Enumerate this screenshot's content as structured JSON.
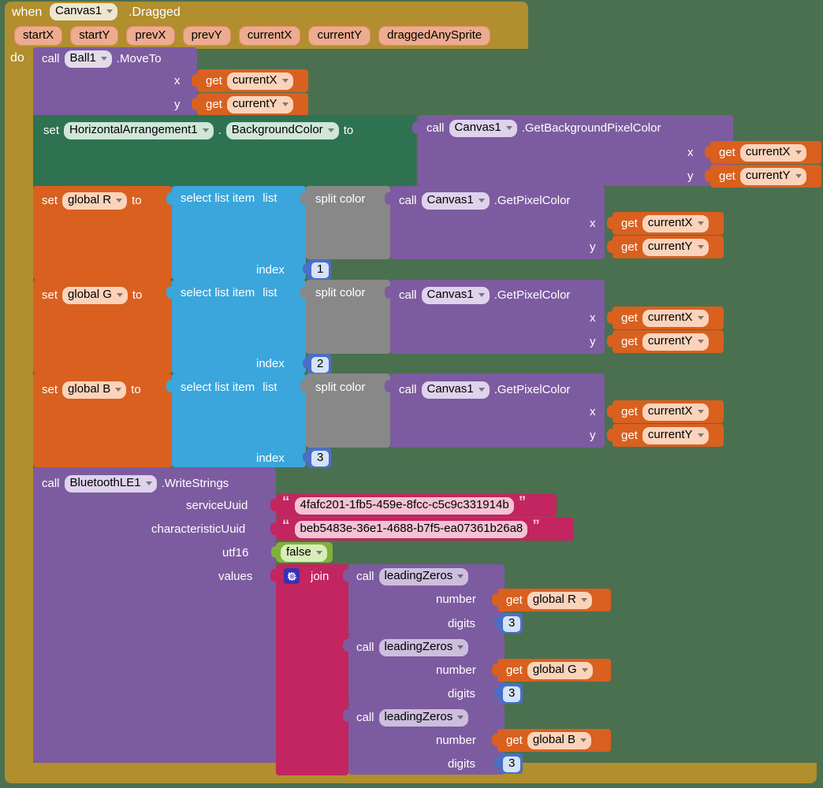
{
  "canvas": {
    "background_color": "#4a7050"
  },
  "event": {
    "when_label": "when",
    "component": "Canvas1",
    "event_name": ".Dragged",
    "params": [
      "startX",
      "startY",
      "prevX",
      "prevY",
      "currentX",
      "currentY",
      "draggedAnySprite"
    ],
    "do_label": "do",
    "color": "#b18e2e"
  },
  "moveto": {
    "call_label": "call",
    "component": "Ball1",
    "method": ".MoveTo",
    "args": [
      {
        "name": "x",
        "get_label": "get",
        "value": "currentX"
      },
      {
        "name": "y",
        "get_label": "get",
        "value": "currentY"
      }
    ],
    "color": "#7d5ba0"
  },
  "set_bgcolor": {
    "set_label": "set",
    "component": "HorizontalArrangement1",
    "dot": ".",
    "property": "BackgroundColor",
    "to_label": "to",
    "color": "#2e7252",
    "value": {
      "call_label": "call",
      "component": "Canvas1",
      "method": ".GetBackgroundPixelColor",
      "args": [
        {
          "name": "x",
          "get_label": "get",
          "value": "currentX"
        },
        {
          "name": "y",
          "get_label": "get",
          "value": "currentY"
        }
      ]
    }
  },
  "rgb_setters": [
    {
      "set_label": "set",
      "variable": "global R",
      "to_label": "to",
      "select_label": "select list item",
      "list_label": "list",
      "split_label": "split color",
      "index_label": "index",
      "index_value": "1",
      "call_label": "call",
      "component": "Canvas1",
      "method": ".GetPixelColor",
      "args": [
        {
          "name": "x",
          "get_label": "get",
          "value": "currentX"
        },
        {
          "name": "y",
          "get_label": "get",
          "value": "currentY"
        }
      ]
    },
    {
      "set_label": "set",
      "variable": "global G",
      "to_label": "to",
      "select_label": "select list item",
      "list_label": "list",
      "split_label": "split color",
      "index_label": "index",
      "index_value": "2",
      "call_label": "call",
      "component": "Canvas1",
      "method": ".GetPixelColor",
      "args": [
        {
          "name": "x",
          "get_label": "get",
          "value": "currentX"
        },
        {
          "name": "y",
          "get_label": "get",
          "value": "currentY"
        }
      ]
    },
    {
      "set_label": "set",
      "variable": "global B",
      "to_label": "to",
      "select_label": "select list item",
      "list_label": "list",
      "split_label": "split color",
      "index_label": "index",
      "index_value": "3",
      "call_label": "call",
      "component": "Canvas1",
      "method": ".GetPixelColor",
      "args": [
        {
          "name": "x",
          "get_label": "get",
          "value": "currentX"
        },
        {
          "name": "y",
          "get_label": "get",
          "value": "currentY"
        }
      ]
    }
  ],
  "write_strings": {
    "call_label": "call",
    "component": "BluetoothLE1",
    "method": ".WriteStrings",
    "color": "#7d5ba0",
    "params": {
      "service_uuid_label": "serviceUuid",
      "service_uuid_value": "4fafc201-1fb5-459e-8fcc-c5c9c331914b",
      "characteristic_uuid_label": "characteristicUuid",
      "characteristic_uuid_value": "beb5483e-36e1-4688-b7f5-ea07361b26a8",
      "utf16_label": "utf16",
      "utf16_value": "false",
      "values_label": "values"
    },
    "join": {
      "label": "join",
      "mutator_icon": "gear-icon",
      "color": "#c2255f",
      "items": [
        {
          "call_label": "call",
          "procedure": "leadingZeros",
          "number_label": "number",
          "get_label": "get",
          "number_value": "global R",
          "digits_label": "digits",
          "digits_value": "3"
        },
        {
          "call_label": "call",
          "procedure": "leadingZeros",
          "number_label": "number",
          "get_label": "get",
          "number_value": "global G",
          "digits_label": "digits",
          "digits_value": "3"
        },
        {
          "call_label": "call",
          "procedure": "leadingZeros",
          "number_label": "number",
          "get_label": "get",
          "number_value": "global B",
          "digits_label": "digits",
          "digits_value": "3"
        }
      ]
    }
  }
}
